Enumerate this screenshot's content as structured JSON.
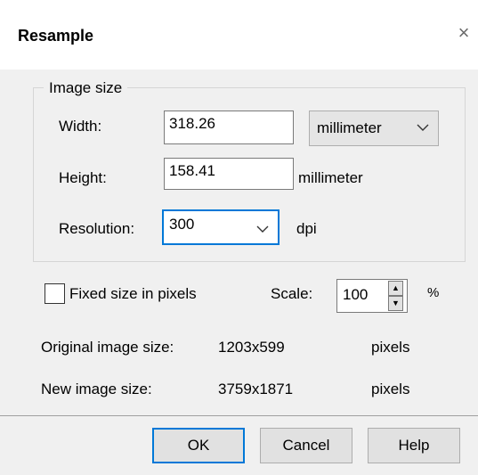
{
  "window": {
    "title": "Resample",
    "close_glyph": "×"
  },
  "image_size": {
    "legend": "Image size",
    "width_label": "Width:",
    "width_value": "318.26",
    "unit_select": "millimeter",
    "height_label": "Height:",
    "height_value": "158.41",
    "height_unit": "millimeter",
    "resolution_label": "Resolution:",
    "resolution_value": "300",
    "resolution_unit": "dpi"
  },
  "options": {
    "fixed_size_label": "Fixed size in pixels",
    "fixed_size_checked": false,
    "scale_label": "Scale:",
    "scale_value": "100",
    "scale_unit": "%"
  },
  "info": {
    "original_label": "Original image size:",
    "original_value": "1203x599",
    "original_unit": "pixels",
    "new_label": "New image size:",
    "new_value": "3759x1871",
    "new_unit": "pixels"
  },
  "buttons": {
    "ok": "OK",
    "cancel": "Cancel",
    "help": "Help"
  },
  "icons": {
    "close": "close-icon",
    "dropdown": "chevron-down-icon",
    "spin_up": "triangle-up-icon",
    "spin_down": "triangle-down-icon"
  },
  "colors": {
    "accent": "#0078d7",
    "dialog_bg": "#f0f0f0",
    "button_bg": "#e1e1e1"
  }
}
